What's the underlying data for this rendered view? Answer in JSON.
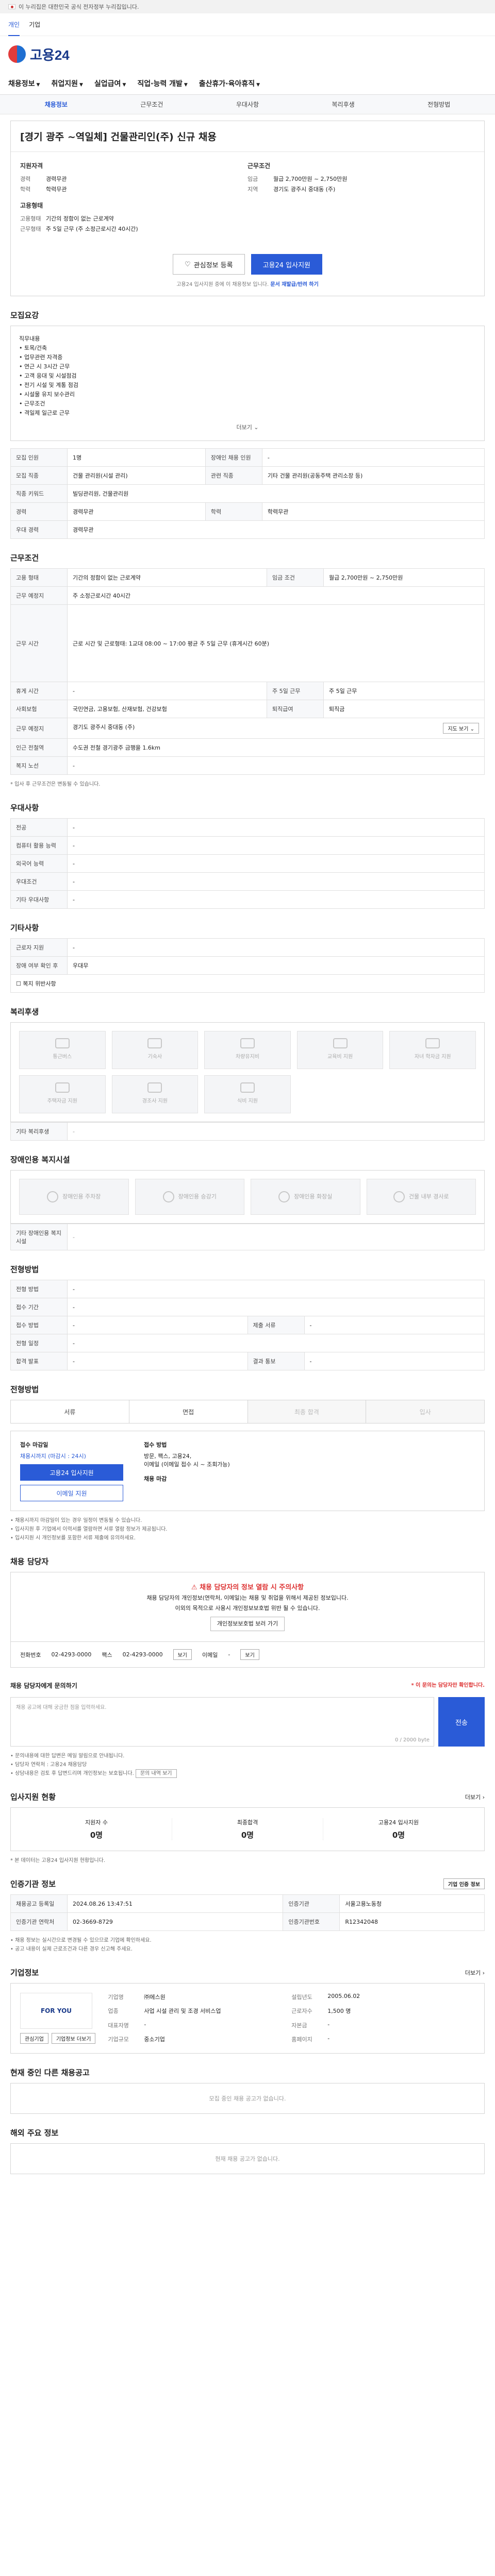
{
  "gov_banner": "이 누리집은 대한민국 공식 전자정부 누리집입니다.",
  "top_tabs": [
    "개인",
    "기업"
  ],
  "logo": "고용24",
  "nav": [
    "채용정보",
    "취업지원",
    "실업급여",
    "직업·능력 개발",
    "출산휴가·육아휴직"
  ],
  "subnav": [
    "채용정보",
    "근무조건",
    "우대사항",
    "복리후생",
    "전형방법"
  ],
  "job": {
    "title": "[경기 광주 ~역일체] 건물관리인(주) 신규 채용",
    "company_h": "지원자격",
    "company": [
      [
        "경력",
        "경력무관"
      ],
      [
        "학력",
        "학력무관"
      ]
    ],
    "cond_h": "근무조건",
    "cond": [
      [
        "임금",
        "월급 2,700만원 ~ 2,750만원"
      ],
      [
        "지역",
        "경기도 광주시 중대동 (주)"
      ]
    ],
    "type_h": "고용형태",
    "type": [
      [
        "고용형태",
        "기간의 정함이 없는 근로계약"
      ],
      [
        "근무형태",
        "주 5일 근무 (주 소정근로시간 40시간)"
      ]
    ],
    "fav_btn": "관심정보 등록",
    "apply_btn": "고용24 입사지원",
    "notice": "고용24 입사지원 중에 이 채용정보 입니다.",
    "notice_link": "문서 재발급/반려 하기"
  },
  "desc": {
    "h": "모집요강",
    "lines": [
      "직무내용",
      "• 토목/건축",
      "• 업무관련 자격증",
      "• 연근 시 3시간 근무",
      "• 고객 응대 및 시설점검",
      "• 전기 시설 및 계통 점검",
      "• 시설물 유지 보수관리",
      "",
      "• 근무조건",
      "• 격일제 일근로 근무"
    ],
    "more": "더보기 ⌄"
  },
  "req": {
    "rows": [
      [
        "모집 인원",
        "1명",
        "장애인 채용 인원",
        "-"
      ],
      [
        "모집 직종",
        "건물 관리원(시설 관리)",
        "관련 직종",
        "기타 건물 관리원(공동주택 관리소장 등)"
      ],
      [
        "직종 키워드",
        "빌딩관리원, 건물관리원",
        "",
        ""
      ],
      [
        "경력",
        "경력무관",
        "학력",
        "학력무관"
      ],
      [
        "우대 경력",
        "경력무관",
        "",
        ""
      ]
    ]
  },
  "work": {
    "h": "근무조건",
    "rows": [
      [
        "고용 형태",
        "기간의 정함이 없는 근로계약",
        "임금 조건",
        "월급 2,700만원 ~ 2,750만원"
      ],
      [
        "근무 예정지",
        "주 소정근로시간 40시간",
        "",
        ""
      ],
      [
        "근무 시간",
        "근로 시간 및 근로형태: 1교대 08:00 ~ 17:00 평균 주 5일 근무 (휴게시간 60분)",
        "",
        ""
      ],
      [
        "휴게 시간",
        "-",
        "주 5일 근무",
        "주 5일 근무"
      ],
      [
        "사회보험",
        "국민연금, 고용보험, 산재보험, 건강보험",
        "퇴직급여",
        "퇴직금"
      ],
      [
        "근무 예정지",
        "경기도 광주시 중대동 (주)",
        "",
        ""
      ],
      [
        "인근 전철역",
        "수도권 전철 경기광주 금행을 1.6km",
        "",
        ""
      ],
      [
        "복지 노선",
        "-",
        "",
        ""
      ]
    ],
    "map_btn": "지도 보기 ⌄",
    "caption": "* 입사 후 근무조건은 변동될 수 있습니다."
  },
  "pref": {
    "h": "우대사항",
    "rows": [
      [
        "전공",
        "-"
      ],
      [
        "컴퓨터 활용 능력",
        "-"
      ],
      [
        "외국어 능력",
        "-"
      ],
      [
        "우대조건",
        "-"
      ],
      [
        "기타 우대사항",
        "-"
      ]
    ]
  },
  "other": {
    "h": "기타사항",
    "rows": [
      [
        "근로자 지원",
        "-"
      ],
      [
        "장애 여부 확인 후",
        "우대무"
      ]
    ],
    "check": "☐ 복지 위반사항"
  },
  "welfare": {
    "h": "복리후생",
    "items": [
      "통근버스",
      "기숙사",
      "차량유지비",
      "교육비 지원",
      "자녀 학자금 지원",
      "주택자금 지원",
      "경조사 지원",
      "식비 지원"
    ],
    "other": "기타 복리후생"
  },
  "disability": {
    "h": "장애인용 복지시설",
    "items": [
      "장애인용 주차장",
      "장애인용 승강기",
      "장애인용 화장실",
      "건물 내부 경사로"
    ],
    "other": "기타 장애인용 복지시설"
  },
  "selection": {
    "h": "전형방법",
    "rows": [
      [
        "전형 방법",
        "-",
        "",
        ""
      ],
      [
        "접수 기간",
        "-",
        "",
        "-"
      ],
      [
        "접수 방법",
        "-",
        "제출 서류",
        "-"
      ],
      [
        "전형 일정",
        "-",
        "",
        ""
      ],
      [
        "합격 발표",
        "-",
        "결과 통보",
        "-"
      ]
    ]
  },
  "process": {
    "h": "전형방법",
    "tabs": [
      "서류",
      "면접",
      "최종 합격",
      "입사"
    ]
  },
  "apply": {
    "h1": "접수 마감일",
    "deadline": "채용시까지 (마감시 : 24시)",
    "h2": "접수 방법",
    "methods": [
      "방문, 팩스, 고용24,",
      "이메일 (이메일 접수 시 ~ 조회가능)"
    ],
    "btn1": "고용24 입사지원",
    "btn2": "이메일 지원",
    "h3": "채용 마감",
    "bul": [
      "• 채용시까지 마감일이 있는 경우 일정이 변동될 수 있습니다.",
      "• 입사지원 후 기업에서 이력서를 열람하면 서류 열람 정보가 제공됩니다.",
      "• 입사지원 시 개인정보를 포함한 서류 제출에 유의하세요."
    ]
  },
  "contact": {
    "h": "채용 담당자",
    "warn": "채용 담당자의 정보 열람 시 주의사항",
    "lines": [
      "채용 담당자의 개인정보(연락처, 이메일)는 채용 및 취업을 위해서 제공된 정보입니다.",
      "이외의 목적으로 사용시 개인정보보호법 위반 될 수 있습니다."
    ],
    "pill": "개인정보보호법 보러 가기",
    "fields": [
      [
        "전화번호",
        "02-4293-0000"
      ],
      [
        "팩스",
        "02-4293-0000"
      ],
      [
        "이메일",
        "-"
      ]
    ],
    "phone_btn": "보기",
    "email_btn": "보기"
  },
  "inquiry": {
    "h": "채용 담당자에게 문의하기",
    "note": "* 이 문의는 담당자만 확인합니다.",
    "placeholder": "채용 공고에 대해 궁금한 점을 입력하세요.",
    "count": "0 / 2000 byte",
    "send": "전송",
    "bul": [
      "• 문의내용에 대한 답변은 메일 알림으로 안내됩니다.",
      "• 담당자 연락처 : 고용24 채용담당",
      "• 상담내용은 검토 후 답변드리며 개인정보는 보호됩니다."
    ],
    "bul_btn": "문의 내역 보기"
  },
  "stats": {
    "h": "입사지원 현황",
    "more": "더보기 ›",
    "items": [
      [
        "지원자 수",
        "0명"
      ],
      [
        "최종합격",
        "0명"
      ],
      [
        "고용24 입사지원",
        "0명"
      ]
    ],
    "note": "* 본 데이터는 고용24 입사지원 현황입니다."
  },
  "regist": {
    "h": "인증기관 정보",
    "btn": "기업 인증 정보",
    "rows": [
      [
        "채용공고 등록일",
        "2024.08.26 13:47:51",
        "인증기관",
        "서울고용노동청"
      ],
      [
        "인증기관 연락처",
        "02-3669-8729",
        "인증기관번호",
        "R12342048",
        "",
        ""
      ]
    ],
    "bul": [
      "• 채용 정보는 실시간으로 변경될 수 있으므로 기업에 확인하세요.",
      "• 공고 내용이 실제 근로조건과 다른 경우 신고해 주세요."
    ]
  },
  "company_info": {
    "h": "기업정보",
    "more": "더보기 ›",
    "logo": "FOR YOU",
    "fields": [
      [
        "기업명",
        "㈜에스원"
      ],
      [
        "업종",
        "사업 시설 관리 및 조경 서비스업"
      ],
      [
        "대표자명",
        "-"
      ],
      [
        "설립년도",
        "2005.06.02"
      ],
      [
        "근로자수",
        "1,500 명"
      ],
      [
        "자본금",
        "-"
      ],
      [
        "기업규모",
        "중소기업"
      ],
      [
        "홈페이지",
        "-"
      ]
    ],
    "btns": [
      "관심기업",
      "기업정보 더보기"
    ]
  },
  "others": {
    "h": "현재 중인 다른 채용공고",
    "empty": "모집 중인 채용 공고가 없습니다."
  },
  "foreign": {
    "h": "해외 주요 정보",
    "empty": "현재 채용 공고가 없습니다."
  }
}
